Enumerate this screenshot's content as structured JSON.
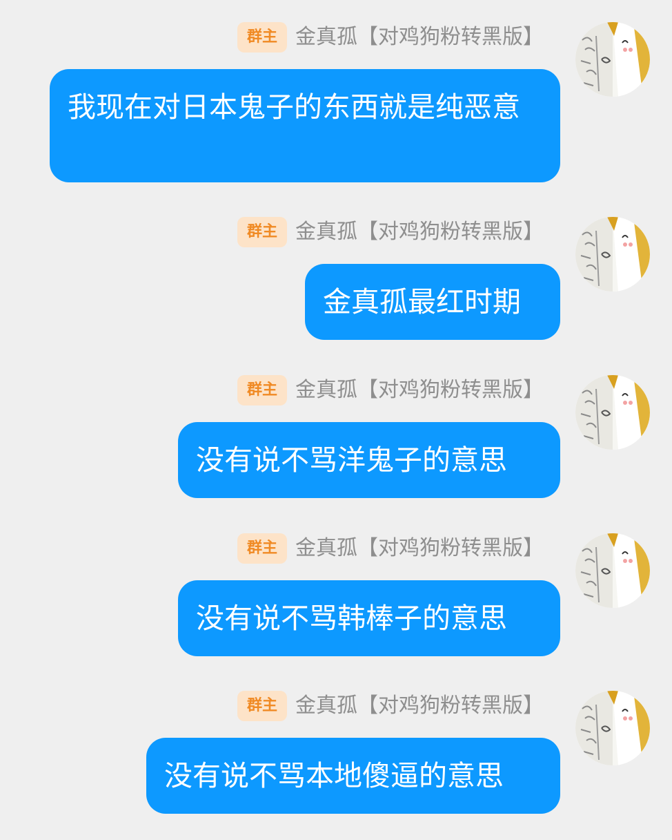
{
  "colors": {
    "background": "#efefef",
    "bubble": "#0d99ff",
    "bubble_text": "#ffffff",
    "badge_bg": "#fde3c8",
    "badge_text": "#f08a24",
    "sender_text": "#8e8e8e"
  },
  "messages": [
    {
      "badge": "群主",
      "sender": "金真孤【对鸡狗粉转黑版】",
      "text": "我现在对日本鬼子的东西就是纯恶意",
      "avatar_icon": "cartoon-avatar-icon"
    },
    {
      "badge": "群主",
      "sender": "金真孤【对鸡狗粉转黑版】",
      "text": "金真孤最红时期",
      "avatar_icon": "cartoon-avatar-icon"
    },
    {
      "badge": "群主",
      "sender": "金真孤【对鸡狗粉转黑版】",
      "text": "没有说不骂洋鬼子的意思",
      "avatar_icon": "cartoon-avatar-icon"
    },
    {
      "badge": "群主",
      "sender": "金真孤【对鸡狗粉转黑版】",
      "text": "没有说不骂韩棒子的意思",
      "avatar_icon": "cartoon-avatar-icon"
    },
    {
      "badge": "群主",
      "sender": "金真孤【对鸡狗粉转黑版】",
      "text": "没有说不骂本地傻逼的意思",
      "avatar_icon": "cartoon-avatar-icon"
    }
  ]
}
